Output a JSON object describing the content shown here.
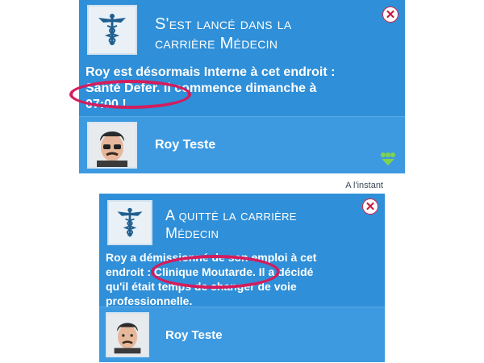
{
  "notifications": [
    {
      "title": "S'est lancé dans la carrière Médecin",
      "title_line1": "S'est lancé dans la",
      "title_line2": "carrière Médecin",
      "body_line1": "Roy est désormais Interne à cet endroit  :",
      "body_line2": "Santé Defer. Il commence dimanche à",
      "body_line3": "07:00  !",
      "person": "Roy Teste",
      "close_symbol": "✕",
      "career_icon": "medical-caduceus-icon",
      "expand_icon": "chevron-down-icon"
    },
    {
      "timestamp": "A l'instant",
      "title_line1": "A quitté la carrière",
      "title_line2": "Médecin",
      "body_line1": "Roy a démissionné de son emploi à cet",
      "body_line2": "endroit : Clinique Moutarde. Il a décidé",
      "body_line3": "qu'il était temps de changer de voie",
      "body_line4": "professionnelle.",
      "person": "Roy Teste",
      "close_symbol": "✕",
      "career_icon": "medical-caduceus-icon"
    }
  ],
  "colors": {
    "panel": "#2f8fd8",
    "person_row": "#3d9ae0",
    "highlight": "#d21d5e",
    "close": "#c4183c"
  }
}
